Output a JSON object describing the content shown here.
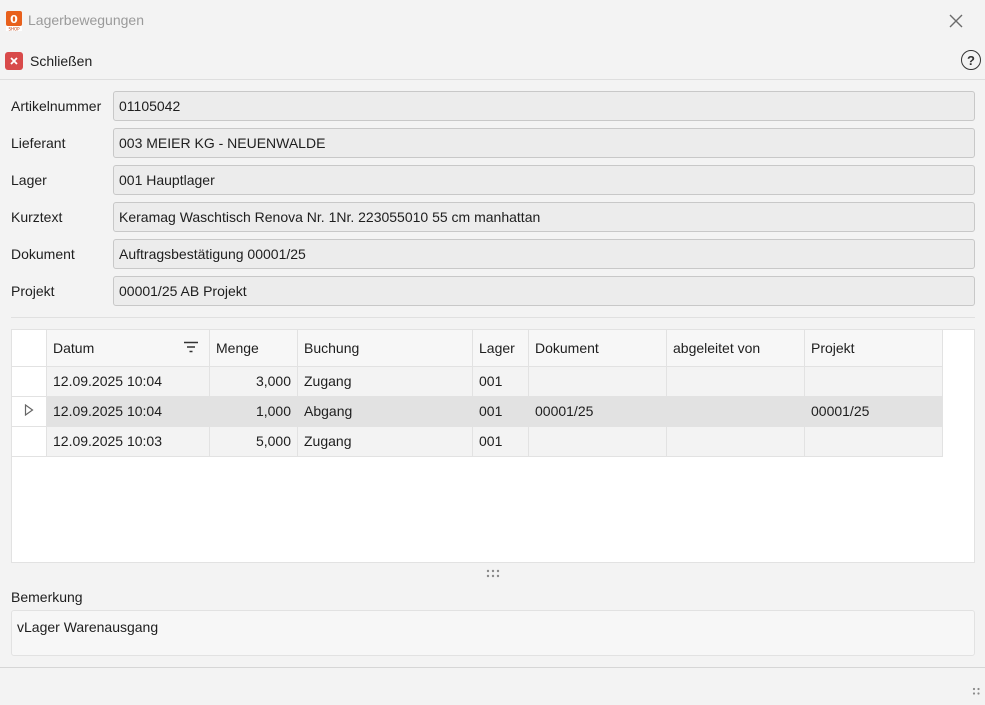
{
  "window": {
    "title": "Lagerbewegungen"
  },
  "toolbar": {
    "close_label": "Schließen",
    "help_symbol": "?"
  },
  "fields": [
    {
      "label": "Artikelnummer",
      "value": "01105042"
    },
    {
      "label": "Lieferant",
      "value": "003 MEIER KG - NEUENWALDE"
    },
    {
      "label": "Lager",
      "value": "001 Hauptlager"
    },
    {
      "label": "Kurztext",
      "value": "Keramag Waschtisch Renova Nr. 1Nr. 223055010 55 cm manhattan"
    },
    {
      "label": "Dokument",
      "value": "Auftragsbestätigung 00001/25"
    },
    {
      "label": "Projekt",
      "value": "00001/25 AB Projekt"
    }
  ],
  "grid": {
    "columns": [
      "Datum",
      "Menge",
      "Buchung",
      "Lager",
      "Dokument",
      "abgeleitet von",
      "Projekt"
    ],
    "rows": [
      {
        "datum": "12.09.2025 10:04",
        "menge": "3,000",
        "buchung": "Zugang",
        "lager": "001",
        "dokument": "",
        "abgeleitet": "",
        "projekt": ""
      },
      {
        "datum": "12.09.2025 10:04",
        "menge": "1,000",
        "buchung": "Abgang",
        "lager": "001",
        "dokument": "00001/25",
        "abgeleitet": "",
        "projekt": "00001/25"
      },
      {
        "datum": "12.09.2025 10:03",
        "menge": "5,000",
        "buchung": "Zugang",
        "lager": "001",
        "dokument": "",
        "abgeleitet": "",
        "projekt": ""
      }
    ]
  },
  "remark": {
    "label": "Bemerkung",
    "value": "vLager Warenausgang"
  },
  "colors": {
    "close_button": "#d84a4a",
    "logo": "#e8601c",
    "selected_row": "#e2e2e2"
  },
  "icons": [
    "app-logo-icon",
    "window-close-icon",
    "close-x-icon",
    "help-icon",
    "filter-icon",
    "row-pointer-icon",
    "splitter-grip-icon",
    "resize-grip-icon"
  ]
}
